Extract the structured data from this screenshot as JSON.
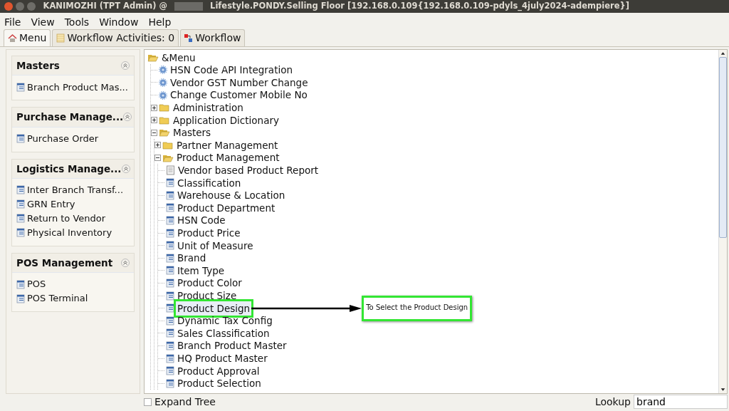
{
  "window": {
    "title_left": "KANIMOZHI (TPT Admin) @",
    "title_right": "Lifestyle.PONDY.Selling Floor [192.168.0.109{192.168.0.109-pdyls_4july2024-adempiere}]"
  },
  "menu": [
    "File",
    "View",
    "Tools",
    "Window",
    "Help"
  ],
  "tabs": [
    {
      "label": "Menu",
      "selected": true
    },
    {
      "label": "Workflow Activities: 0",
      "selected": false
    },
    {
      "label": "Workflow",
      "selected": false
    }
  ],
  "sidebar": [
    {
      "title": "Masters",
      "items": [
        "Branch Product Mas..."
      ]
    },
    {
      "title": "Purchase Manage...",
      "items": [
        "Purchase Order"
      ]
    },
    {
      "title": "Logistics Manage...",
      "items": [
        "Inter Branch Transf...",
        "GRN Entry",
        "Return to Vendor",
        "Physical Inventory"
      ]
    },
    {
      "title": "POS Management",
      "items": [
        "POS",
        "POS Terminal"
      ]
    }
  ],
  "tree": {
    "label": "&Menu",
    "kind": "folder",
    "expanded": true,
    "children": [
      {
        "label": "HSN Code API Integration",
        "kind": "process"
      },
      {
        "label": "Vendor GST Number Change",
        "kind": "process"
      },
      {
        "label": "Change Customer Mobile No",
        "kind": "process"
      },
      {
        "label": "Administration",
        "kind": "folder",
        "expanded": false
      },
      {
        "label": "Application Dictionary",
        "kind": "folder",
        "expanded": false
      },
      {
        "label": "Masters",
        "kind": "folder",
        "expanded": true,
        "children": [
          {
            "label": "Partner Management",
            "kind": "folder",
            "expanded": false
          },
          {
            "label": "Product Management",
            "kind": "folder",
            "expanded": true,
            "children": [
              {
                "label": "Vendor based Product Report",
                "kind": "report",
                "highlighted": false
              },
              {
                "label": "Classification",
                "kind": "window",
                "highlighted": false
              },
              {
                "label": "Warehouse & Location",
                "kind": "window",
                "highlighted": false
              },
              {
                "label": "Product Department",
                "kind": "window",
                "highlighted": false
              },
              {
                "label": "HSN Code",
                "kind": "window",
                "highlighted": false
              },
              {
                "label": "Product Price",
                "kind": "window",
                "highlighted": false
              },
              {
                "label": "Unit of Measure",
                "kind": "window",
                "highlighted": false
              },
              {
                "label": "Brand",
                "kind": "window",
                "highlighted": false
              },
              {
                "label": "Item Type",
                "kind": "window",
                "highlighted": false
              },
              {
                "label": "Product Color",
                "kind": "window",
                "highlighted": false
              },
              {
                "label": "Product Size",
                "kind": "window",
                "highlighted": false
              },
              {
                "label": "Product Design",
                "kind": "window",
                "highlighted": true
              },
              {
                "label": "Dynamic Tax Config",
                "kind": "window",
                "highlighted": false
              },
              {
                "label": "Sales Classification",
                "kind": "window",
                "highlighted": false
              },
              {
                "label": "Branch Product Master",
                "kind": "window",
                "highlighted": false
              },
              {
                "label": "HQ Product Master",
                "kind": "window",
                "highlighted": false
              },
              {
                "label": "Product Approval",
                "kind": "window",
                "highlighted": false
              },
              {
                "label": "Product Selection",
                "kind": "window",
                "highlighted": false
              }
            ]
          }
        ]
      }
    ]
  },
  "annotation": {
    "text": "To Select the Product Design"
  },
  "footer": {
    "expand_tree": {
      "label": "Expand Tree",
      "checked": false
    },
    "lookup": {
      "label": "Lookup",
      "value": "brand"
    }
  }
}
